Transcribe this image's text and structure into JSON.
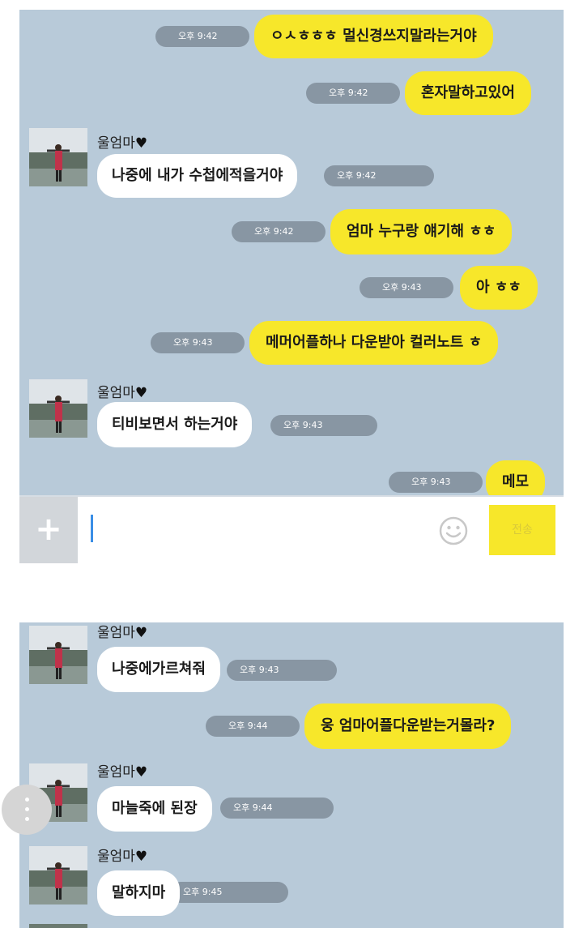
{
  "screenshot1": {
    "messages": [
      {
        "side": "me",
        "text": "ㅇㅅㅎㅎㅎ 멀신경쓰지말라는거야",
        "time": "오후 9:42"
      },
      {
        "side": "me",
        "text": "혼자말하고있어",
        "time": "오후 9:42"
      },
      {
        "side": "other",
        "sender": "울엄마",
        "text": "나중에 내가 수첩에적을거야",
        "time": "오후 9:42"
      },
      {
        "side": "me",
        "text": "엄마 누구랑 얘기해 ㅎㅎ",
        "time": "오후 9:42"
      },
      {
        "side": "me",
        "text": "아 ㅎㅎ",
        "time": "오후 9:43"
      },
      {
        "side": "me",
        "text": "메머어플하나 다운받아 컬러노트 ㅎ",
        "time": "오후 9:43"
      },
      {
        "side": "other",
        "sender": "울엄마",
        "text": "티비보면서 하는거야",
        "time": "오후 9:43"
      },
      {
        "side": "me",
        "text": "메모",
        "time": "오후 9:43"
      }
    ],
    "input": {
      "plus": "+",
      "send": "전송",
      "emoji_icon": "smiley-icon"
    }
  },
  "screenshot2": {
    "messages": [
      {
        "side": "other",
        "sender": "울엄마",
        "text": "나중에가르쳐줘",
        "time": "오후 9:43"
      },
      {
        "side": "me",
        "text": "웅 엄마어플다운받는거몰라?",
        "time": "오후 9:44"
      },
      {
        "side": "other",
        "sender": "울엄마",
        "text": "마늘죽에 된장",
        "time": "오후 9:44"
      },
      {
        "side": "other",
        "sender": "울엄마",
        "text": "말하지마",
        "time": "오후 9:45"
      }
    ]
  },
  "heart": "♥",
  "colors": {
    "chat_bg": "#b8cad9",
    "my_bubble": "#f7e72a",
    "other_bubble": "#ffffff",
    "time_pill": "#8896a3"
  }
}
